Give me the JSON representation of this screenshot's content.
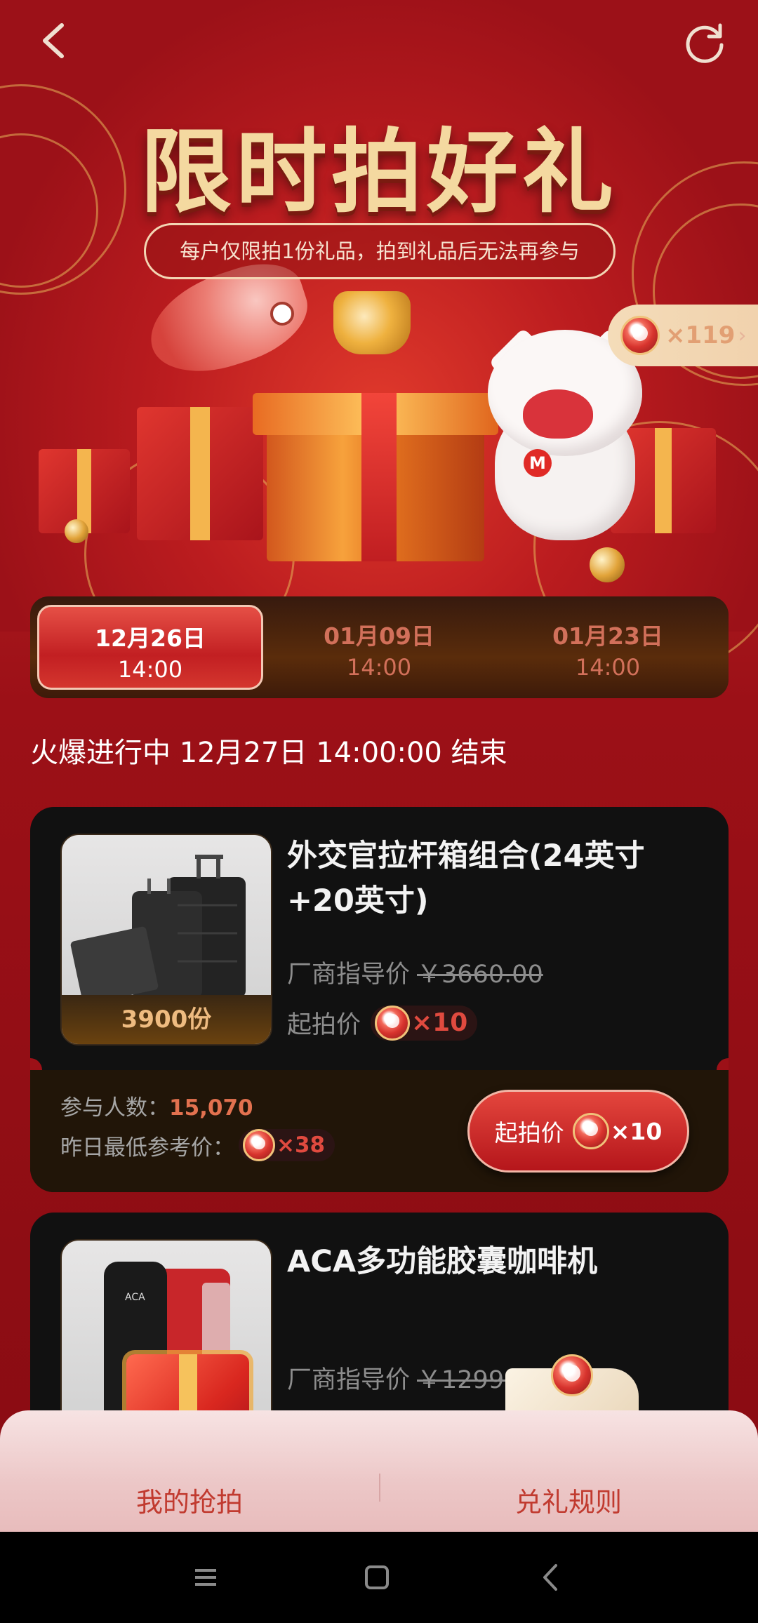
{
  "header": {
    "title": "限时拍好礼",
    "notice": "每户仅限拍1份礼品，拍到礼品后无法再参与",
    "coin_balance": "×119",
    "coin_chevron": "›"
  },
  "date_tabs": [
    {
      "date": "12月26日",
      "time": "14:00",
      "active": true
    },
    {
      "date": "01月09日",
      "time": "14:00",
      "active": false
    },
    {
      "date": "01月23日",
      "time": "14:00",
      "active": false
    }
  ],
  "status_line": "火爆进行中 12月27日 14:00:00 结束",
  "products": [
    {
      "name": "外交官拉杆箱组合(24英寸+20英寸)",
      "stock": "3900份",
      "guide_label": "厂商指导价",
      "guide_price": "￥3660.00",
      "start_label": "起拍价",
      "start_coins": "×10",
      "participants_label": "参与人数：",
      "participants": "15,070",
      "yesterday_label": "昨日最低参考价：",
      "yesterday_coins": "×38",
      "bid_label": "起拍价",
      "bid_coins": "×10"
    },
    {
      "name": "ACA多功能胶囊咖啡机",
      "guide_label": "厂商指导价",
      "guide_price": "￥1299.0"
    }
  ],
  "bottom_bar": {
    "my_bids": "我的抢拍",
    "rules": "兑礼规则"
  },
  "colors": {
    "primary_red": "#a5161b",
    "accent_gold": "#f4d9a0",
    "participants": "#e2714f"
  }
}
